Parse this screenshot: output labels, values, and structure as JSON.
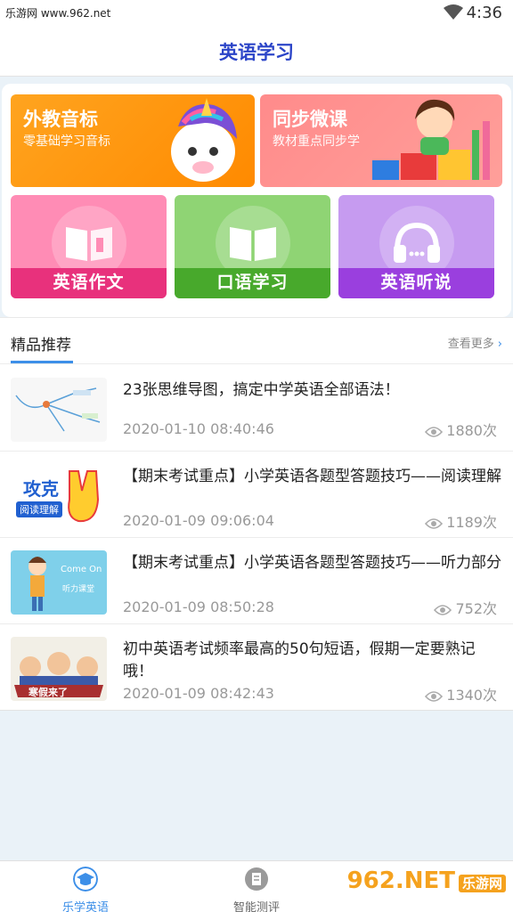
{
  "status_bar": {
    "watermark": "乐游网 www.962.net",
    "time": "4:36"
  },
  "header": {
    "title": "英语学习"
  },
  "banners": [
    {
      "title": "外教音标",
      "subtitle": "零基础学习音标"
    },
    {
      "title": "同步微课",
      "subtitle": "教材重点同步学"
    }
  ],
  "tiles": [
    {
      "label": "英语作文"
    },
    {
      "label": "口语学习"
    },
    {
      "label": "英语听说"
    }
  ],
  "section": {
    "title": "精品推荐",
    "more": "查看更多"
  },
  "articles": [
    {
      "title": "23张思维导图，搞定中学英语全部语法！",
      "date": "2020-01-10 08:40:46",
      "views": "1880次"
    },
    {
      "title": "【期末考试重点】小学英语各题型答题技巧——阅读理解",
      "date": "2020-01-09 09:06:04",
      "views": "1189次",
      "thumb_text": "攻克",
      "thumb_sub": "阅读理解"
    },
    {
      "title": "【期末考试重点】小学英语各题型答题技巧——听力部分",
      "date": "2020-01-09 08:50:28",
      "views": "752次",
      "thumb_text": "Come On",
      "thumb_sub": "听力课堂"
    },
    {
      "title": "初中英语考试频率最高的50句短语，假期一定要熟记哦！",
      "date": "2020-01-09 08:42:43",
      "views": "1340次",
      "thumb_text": "寒假来了"
    }
  ],
  "tabbar": {
    "tab1": "乐学英语",
    "tab2": "智能测评"
  },
  "watermark_logo": {
    "brand": "962.NET",
    "site": "乐游网"
  },
  "colors": {
    "accent": "#3d8fe8",
    "title": "#2c45c8",
    "orange": "#ff9a12",
    "pink": "#ff8b8b"
  }
}
